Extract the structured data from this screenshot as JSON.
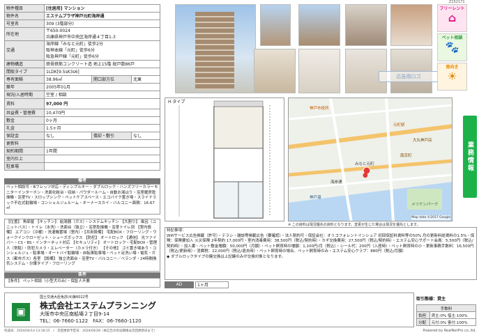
{
  "top_right": "Z152171",
  "spec": {
    "type_label": "物件種目",
    "type_value": "[住居用] マンション",
    "name_label": "物件名",
    "name_value": "エステムプラザ神戸元町海岸通",
    "room_label": "号室名",
    "room_value": "309 (3階部分)",
    "addr_label": "所在地",
    "addr_zip": "〒650-0024",
    "addr_value": "兵庫県神戸市中央区海岸通４丁目1-3",
    "traffic_label": "交通",
    "traffic_1": "海岸線「みなと元町」徒歩2分",
    "traffic_2": "阪神本線「元町」徒歩6分",
    "traffic_3": "阪急神戸線「元町」徒歩6分",
    "struct_label": "建物構造",
    "struct_value": "鉄骨鉄筋コンクリート造 地上15階 総戸数86戸",
    "layout_label": "間取タイプ",
    "layout_value": "1LDK[9.5sK3s6]",
    "area_label": "専有面積",
    "area_value": "38.96㎡",
    "dir_label": "開口部方位",
    "dir_value": "北東",
    "built_label": "築年",
    "built_value": "2005年01月",
    "status_label": "現況/入居時期",
    "status_value": "空室 / 相談",
    "rent_label": "賃料",
    "rent_value": "97,000 円",
    "mgmt_label": "共益費・管理費",
    "mgmt_value": "10,470円",
    "deposit_label": "敷金",
    "deposit_value": "0ヶ月",
    "key_label": "礼金",
    "key_value": "1.5ヶ月",
    "guard_label": "保証金",
    "guard_value": "なし",
    "amort_label": "償却・敷引",
    "amort_value": "なし",
    "renew_label": "更新料",
    "renew_value": "",
    "contract_label": "契約期間",
    "contract_value": "1年間",
    "inner_label": "室内仕上",
    "inner_value": "",
    "parking_label": "駐車場",
    "parking_value": ""
  },
  "remarks": {
    "title": "備考",
    "text": "ペット相談可・Bフレッツ対応・ディンプルキー・ダブルロック・ハンズフリーカラーモニターインターホン・洗面化粧台・収納・パウダールーム・自動お湯はり・浴室暖房乾燥機・浴室TV・スロップシンク・ペットケアスペース・エコバイク置き場・スライドラック不在式駐輪場・コンシェルジュルーム・オーナースカイ・バルコニー面積：16.67㎡"
  },
  "features": {
    "text": "【位置】 角部屋 【キッチン】 給湯器（ガス）・システムキッチン 【大割り】 風呂（ユニットバス）・トイレ（水洗）・洗面台（独立）・浴室乾燥機・浴室トイレ別 【室内設備】 エアコン（冷暖）・洗濯機置場（室内）・【共用設備】 宅配BOX・フローリング・ウォークインクローゼット・シューズボックス 【防犯】 オートロック 【通信】 光ファイバー・CS・BS・インターネット対応 【セキュリティ】 オートロック・宅配BOX・管理人（常駐）・防犯カメラ・エレベーター（カメラ付き） 【その他】 ゴミ置き場あり・コンシェルジュ・駐車場・オートバイ駐輪場・自転車駐車場・ペット足洗い場・電気・ガス（都市ガス）各室 【設備】 独立洗面台・浴室TV・バルコニー／ベランダ・24時間換気システム・分譲タイプ・フローリング"
  },
  "conditions": {
    "title": "条件",
    "text": "【条件】 ペット相談（小型犬のみ）・保証人不要"
  },
  "photo_caption": "H タイプ",
  "banner_ad": "広告用ロゴ",
  "badges": {
    "free": "フリーレント",
    "pet": "ペット相談",
    "sun": "南向き"
  },
  "side_tab": "業務情報",
  "notes": {
    "title": "特記事項：",
    "text": "Wifiサービス広告掲載（許可）・テラシ・雑誌等掲載広告（要確認）・法人契約可・保証会社：オリコフォレントインシュア 初回保証料賃料等の50% 月の更新料総賃料の1.5%・保険：保険要加入 火災保険 2年契約 17,000円・室内消毒費用：38,500円（税込/契約時）・カギ交換費用：27,500円（税込/契約時）・エステム安心サポート会員：5,500円（税込/契約時）・加入書・ペット敷金増額：50,000円（月額）・ペット飼育時の増額：1,100円/月（税込）・シール代：200円（入居時）・ペット飼育時の小・更新事務手数料：16,500円（税込/更新時）・消費税：22,000円（税込/退去時）・ペット飼育時の場合、ペット飼育時のみ・エステム安心クラブ：880円（税込/月額）",
    "extra": "◆ ダブルロックタイプの鍵交換は上記鍵のみが交換対象となります。"
  },
  "ad_label": "AD",
  "ad_value": "1ヶ月",
  "company": {
    "license": "国土交通大臣免許(4)第6022号",
    "name": "株式会社エステムプランニング",
    "address": "大阪市中央区南船場２丁目9-14",
    "tel": "TEL：06-7660-1122　FAX：06-7660-1120"
  },
  "fee": {
    "title": "取引態様：貸主",
    "sub": "手数料",
    "row1_label": "負担",
    "row1_value": "貸主:0% 借主:100%",
    "row2_label": "分配",
    "row2_value": "元付:0% 客付:100%"
  },
  "footer_left": "作成日：2024/04/14 13:18:15　/　次回更新予定日：2024/04/28（本広告の有効期限は次回更新日まで）",
  "footer_right": "Powered by RealNetPro co.,ltd.",
  "map_copyright": "Map data ©2017 Google",
  "map_note": "※ この資料は現況優先の資料となります。変更が生じた場合は現況を優先とします。",
  "map_labels": {
    "l1": "神戸市役所",
    "l2": "元町駅",
    "l3": "大丸神戸店",
    "l4": "南京町",
    "l5": "みなと元町",
    "l6": "メリケンパーク",
    "l7": "神戸港",
    "l8": "海岸通"
  }
}
